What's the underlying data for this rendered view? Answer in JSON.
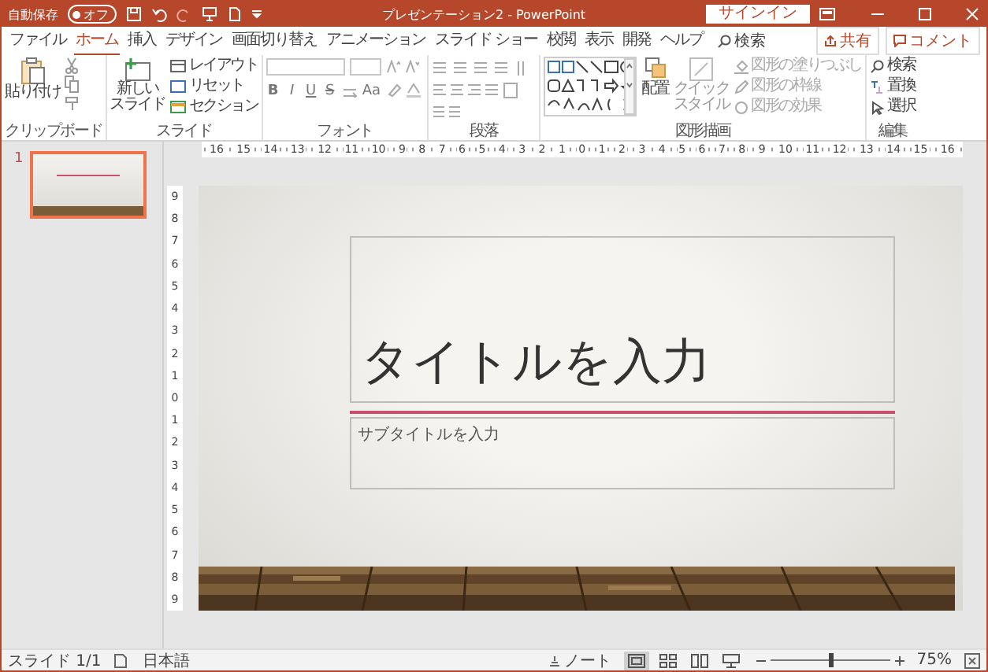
{
  "title_bar": {
    "autosave_label": "自動保存",
    "autosave": {
      "label": "オフ",
      "on": false
    },
    "title": "プレゼンテーション2 - PowerPoint",
    "sign_in": "サインイン"
  },
  "tabs": [
    {
      "label": "ファイル",
      "selected": false
    },
    {
      "label": "ホーム",
      "selected": true
    },
    {
      "label": "挿入",
      "selected": false
    },
    {
      "label": "デザイン",
      "selected": false
    },
    {
      "label": "画面切り替え",
      "selected": false
    },
    {
      "label": "アニメーション",
      "selected": false
    },
    {
      "label": "スライド ショー",
      "selected": false
    },
    {
      "label": "校閲",
      "selected": false
    },
    {
      "label": "表示",
      "selected": false
    },
    {
      "label": "開発",
      "selected": false
    },
    {
      "label": "ヘルプ",
      "selected": false
    }
  ],
  "tell_me": "検索",
  "share": "共有",
  "comments": "コメント",
  "ribbon": {
    "clipboard": {
      "paste": "貼り付け",
      "label": "クリップボード"
    },
    "slides": {
      "new_slide": [
        "新しい",
        "スライド"
      ],
      "layout": "レイアウト",
      "reset": "リセット",
      "section": "セクション",
      "label": "スライド"
    },
    "font": {
      "format_buttons": [
        "B",
        "I",
        "U",
        "S"
      ],
      "case_button": "Aa",
      "label": "フォント"
    },
    "paragraph": {
      "label": "段落"
    },
    "drawing": {
      "arrange": "配置",
      "quick_styles": [
        "クイック",
        "スタイル"
      ],
      "fill": "図形の塗りつぶし",
      "outline": "図形の枠線",
      "effects": "図形の効果",
      "label": "図形描画"
    },
    "editing": {
      "find": "検索",
      "replace": "置換",
      "select": "選択",
      "label": "編集"
    }
  },
  "ruler": {
    "horizontal": [
      "16",
      "15",
      "14",
      "13",
      "12",
      "11",
      "10",
      "9",
      "8",
      "7",
      "6",
      "5",
      "4",
      "3",
      "2",
      "1",
      "0",
      "1",
      "2",
      "3",
      "4",
      "5",
      "6",
      "7",
      "8",
      "9",
      "10",
      "11",
      "12",
      "13",
      "14",
      "15",
      "16"
    ],
    "vertical": [
      "9",
      "8",
      "7",
      "6",
      "5",
      "4",
      "3",
      "2",
      "1",
      "0",
      "1",
      "2",
      "3",
      "4",
      "5",
      "6",
      "7",
      "8",
      "9"
    ]
  },
  "thumbnails": [
    {
      "number": "1",
      "selected": true
    }
  ],
  "slide": {
    "title_placeholder": "タイトルを入力",
    "subtitle_placeholder": "サブタイトルを入力"
  },
  "status_bar": {
    "slide": "スライド 1/1",
    "language": "日本語",
    "notes": "ノート",
    "views": [
      {
        "kind": "normal",
        "selected": true
      },
      {
        "kind": "sorter",
        "selected": false
      },
      {
        "kind": "reading",
        "selected": false
      },
      {
        "kind": "show",
        "selected": false
      }
    ],
    "zoom": {
      "level": 0.5,
      "reading": "75%"
    }
  }
}
